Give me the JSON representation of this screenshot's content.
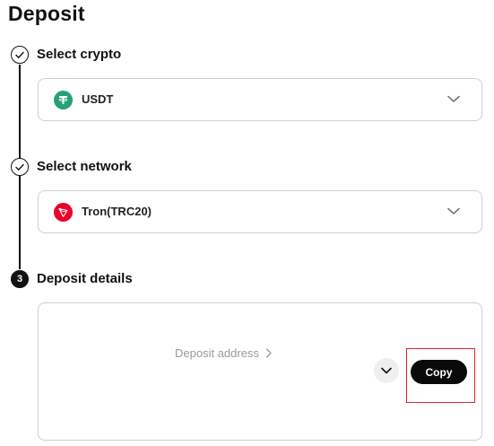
{
  "page": {
    "title": "Deposit"
  },
  "steps": [
    {
      "label": "Select crypto",
      "status": "done",
      "icon": "check-icon"
    },
    {
      "label": "Select network",
      "status": "done",
      "icon": "check-icon"
    },
    {
      "label": "Deposit details",
      "status": "active",
      "number": "3"
    }
  ],
  "crypto_select": {
    "value": "USDT",
    "icon": "tether-icon",
    "icon_color": "#26A17B"
  },
  "network_select": {
    "value": "Tron(TRC20)",
    "icon": "tron-icon",
    "icon_color": "#EB0029"
  },
  "deposit_details": {
    "address_label": "Deposit address",
    "copy_label": "Copy",
    "highlight_color": "#D9272E"
  }
}
